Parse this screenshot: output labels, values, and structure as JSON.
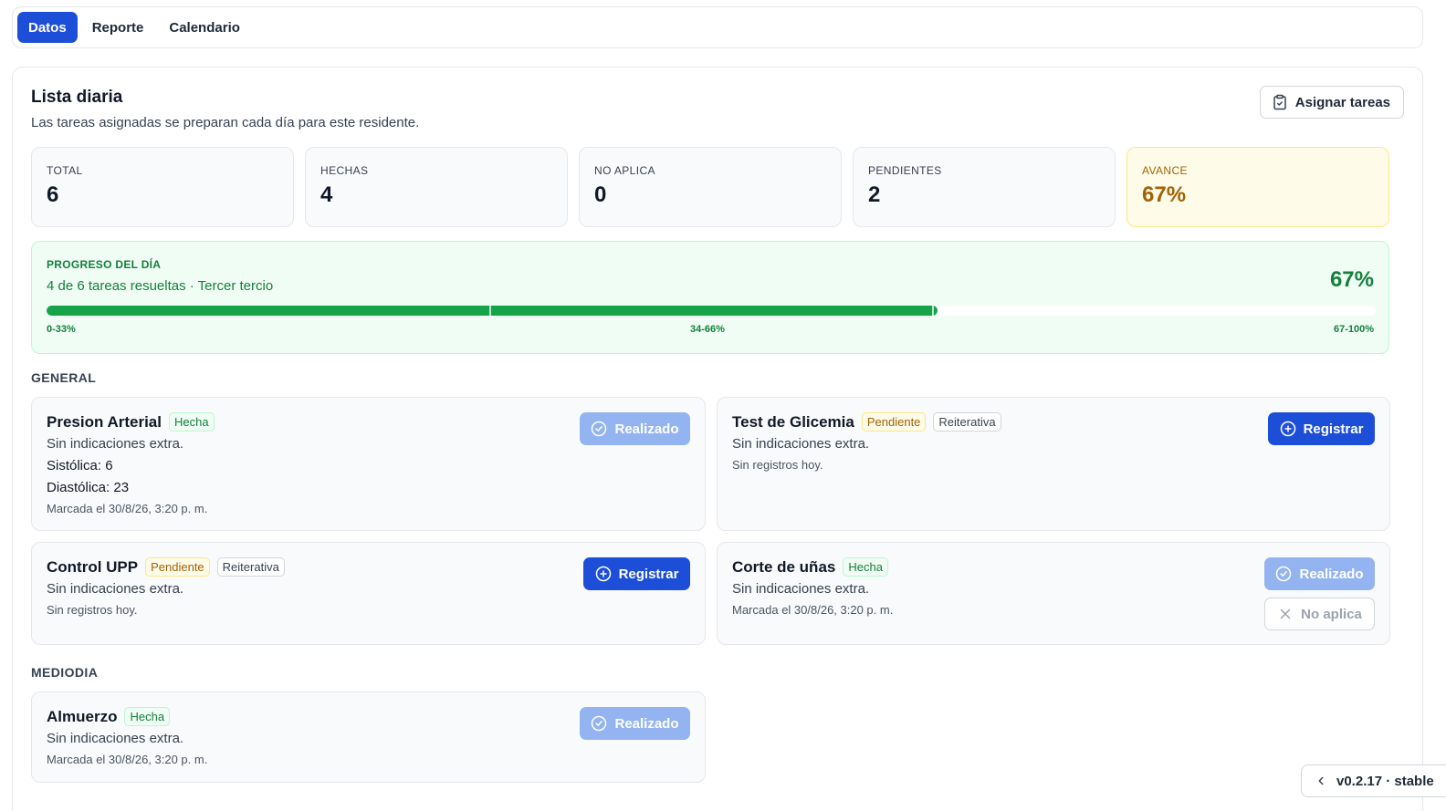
{
  "tabs": [
    {
      "label": "Datos",
      "active": true
    },
    {
      "label": "Reporte",
      "active": false
    },
    {
      "label": "Calendario",
      "active": false
    }
  ],
  "header": {
    "title": "Lista diaria",
    "subtitle": "Las tareas asignadas se preparan cada día para este residente.",
    "assign_label": "Asignar tareas"
  },
  "stats": [
    {
      "label": "TOTAL",
      "value": "6"
    },
    {
      "label": "HECHAS",
      "value": "4"
    },
    {
      "label": "NO APLICA",
      "value": "0"
    },
    {
      "label": "PENDIENTES",
      "value": "2"
    },
    {
      "label": "AVANCE",
      "value": "67%"
    }
  ],
  "progress": {
    "label": "PROGRESO DEL DÍA",
    "text": "4 de 6 tareas resueltas · Tercer tercio",
    "percent_text": "67%",
    "fraction": 0.67,
    "segments": [
      "0-33%",
      "34-66%",
      "67-100%"
    ]
  },
  "sections": {
    "general": "GENERAL",
    "mediodia": "MEDIODIA"
  },
  "tasks": {
    "presion": {
      "name": "Presion Arterial",
      "badge": "Hecha",
      "ind": "Sin indicaciones extra.",
      "lines": [
        "Sistólica: 6",
        "Diastólica: 23"
      ],
      "meta": "Marcada el 30/8/26, 3:20 p. m.",
      "button": "Realizado"
    },
    "glicemia": {
      "name": "Test de Glicemia",
      "badge": "Pendiente",
      "badge2": "Reiterativa",
      "ind": "Sin indicaciones extra.",
      "meta": "Sin registros hoy.",
      "button": "Registrar"
    },
    "upp": {
      "name": "Control UPP",
      "badge": "Pendiente",
      "badge2": "Reiterativa",
      "ind": "Sin indicaciones extra.",
      "meta": "Sin registros hoy.",
      "button": "Registrar"
    },
    "unas": {
      "name": "Corte de uñas",
      "badge": "Hecha",
      "ind": "Sin indicaciones extra.",
      "meta": "Marcada el 30/8/26, 3:20 p. m.",
      "button": "Realizado",
      "button2": "No aplica"
    },
    "almuerzo": {
      "name": "Almuerzo",
      "badge": "Hecha",
      "ind": "Sin indicaciones extra.",
      "meta": "Marcada el 30/8/26, 3:20 p. m.",
      "button": "Realizado"
    }
  },
  "version": "v0.2.17 · stable",
  "colors": {
    "primary": "#1d4ed8",
    "success": "#16a34a",
    "warning": "#a16207"
  }
}
